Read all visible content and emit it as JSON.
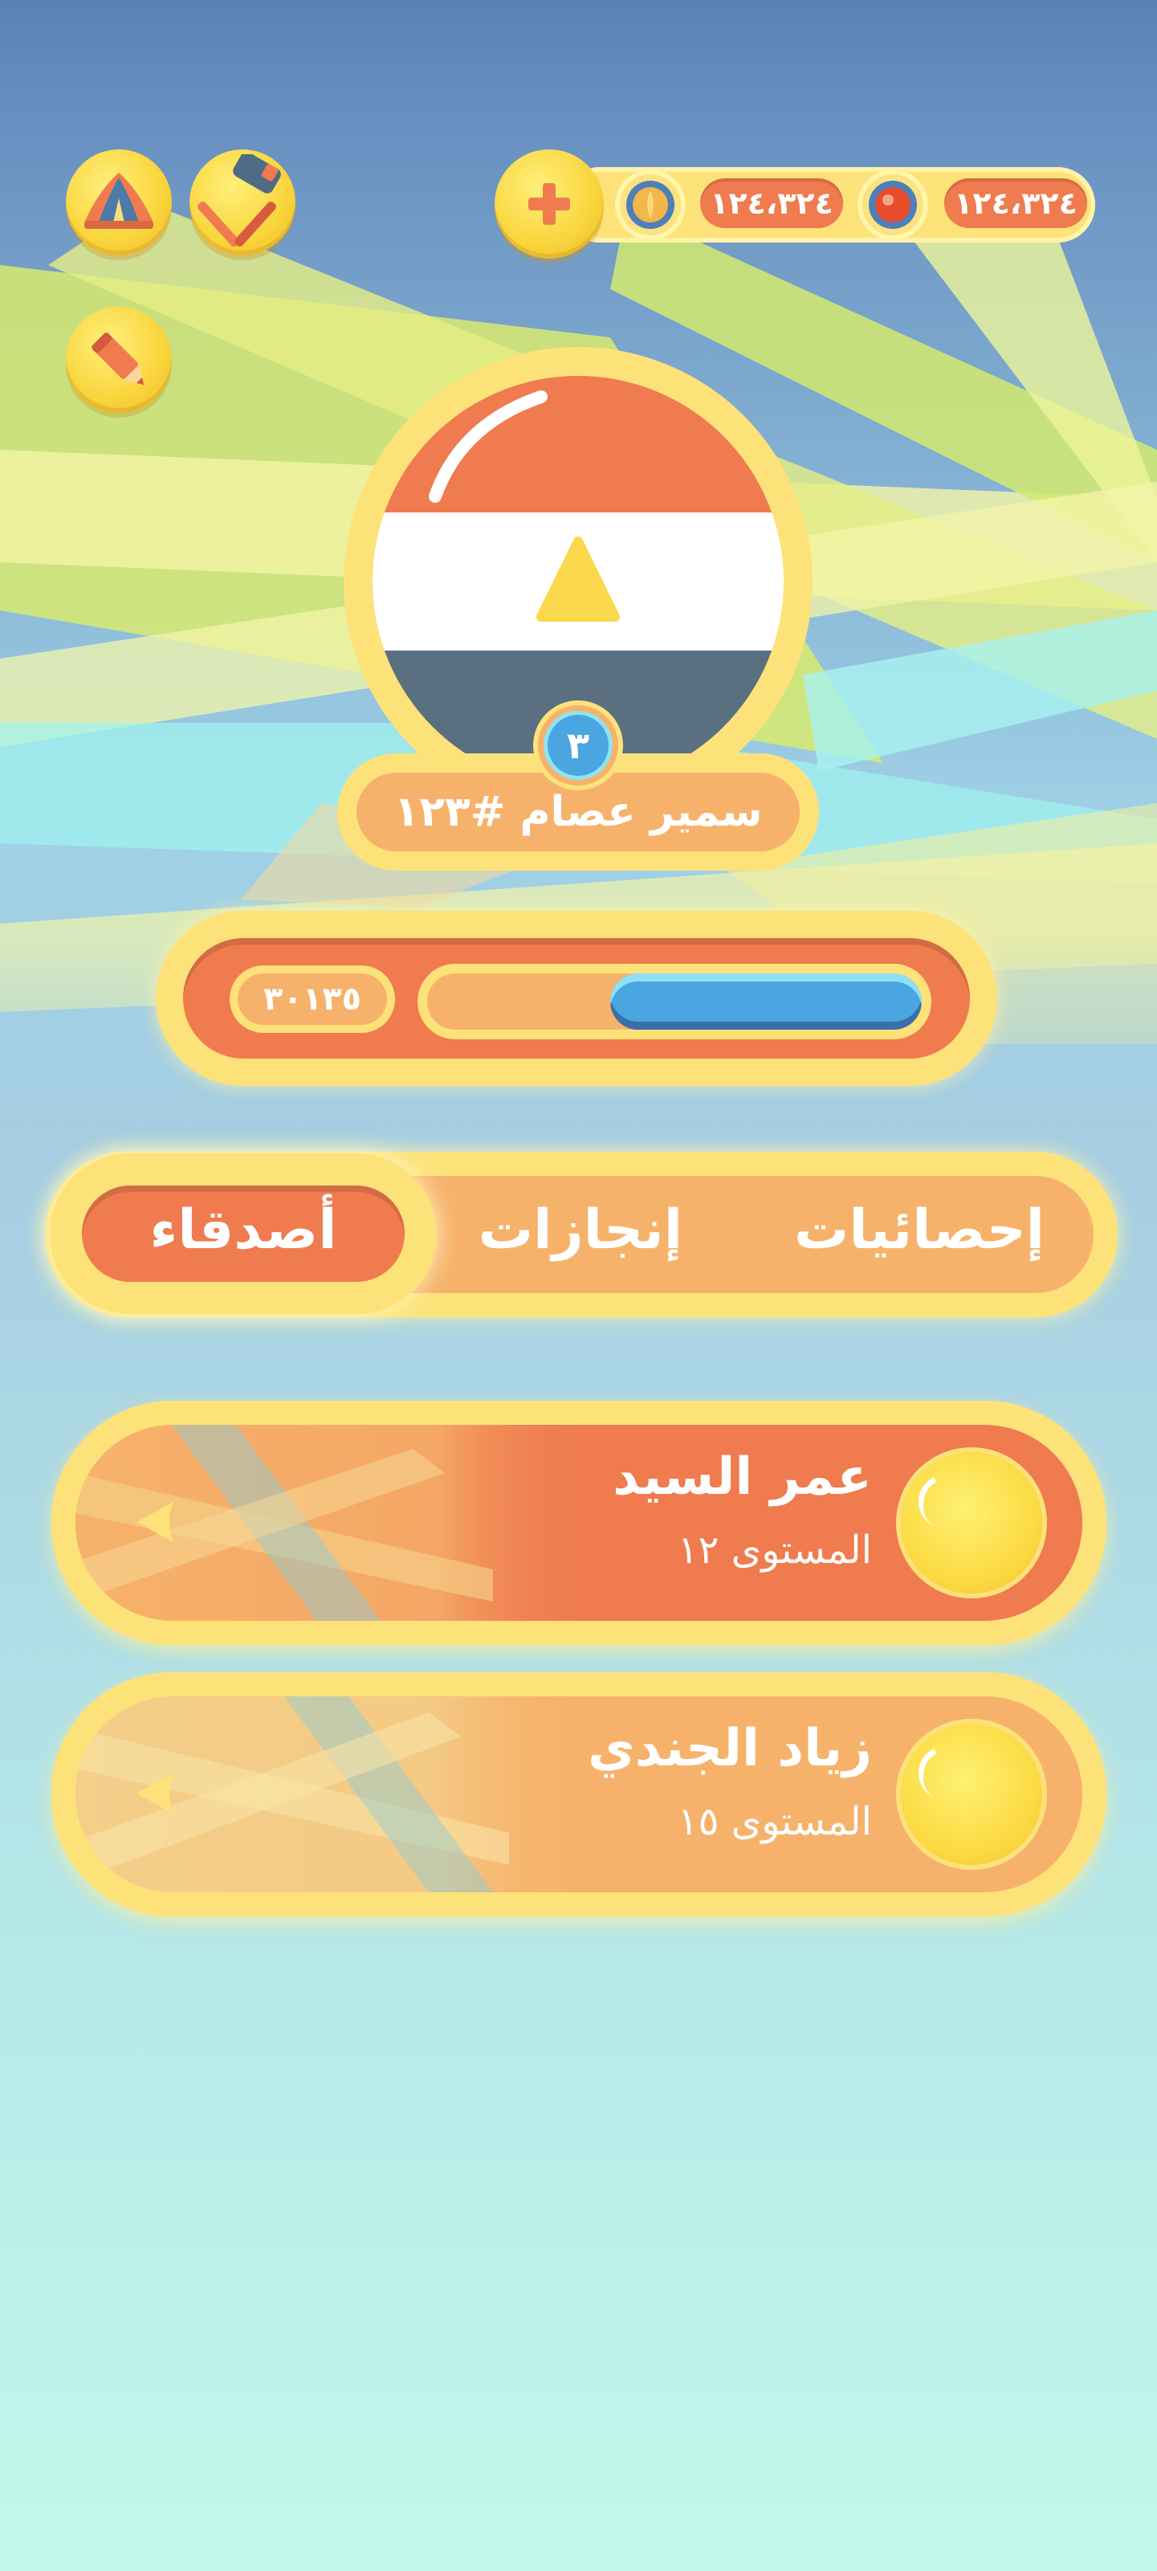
{
  "currency": {
    "gems_value": "١٢٤،٣٢٤",
    "coins_value": "١٢٤،٣٢٤",
    "add_icon": "plus-icon",
    "gems_icon": "red-gem-icon",
    "coins_icon": "gold-coin-icon"
  },
  "toolbar": {
    "icons": [
      "tent-icon",
      "hammer-icon",
      "pencil-icon"
    ]
  },
  "profile": {
    "flag": "egypt-flag-icon",
    "level": "٣",
    "name": "سمير عصام #١٢٣",
    "xp_value": "٣٠١٣٥",
    "xp_progress": 0.63
  },
  "tabs": [
    {
      "label": "إحصائيات",
      "active": false
    },
    {
      "label": "إنجازات",
      "active": false
    },
    {
      "label": "أصدقاء",
      "active": true
    }
  ],
  "friends": [
    {
      "name": "عمر السيد",
      "level": "المستوى ١٢"
    },
    {
      "name": "زياد الجندي",
      "level": "المستوى ١٥"
    }
  ],
  "colors": {
    "accent_orange": "#ef7b4f",
    "accent_yellow": "#fde27a",
    "progress_blue": "#4aa6e0",
    "light_orange": "#f6b26b"
  }
}
